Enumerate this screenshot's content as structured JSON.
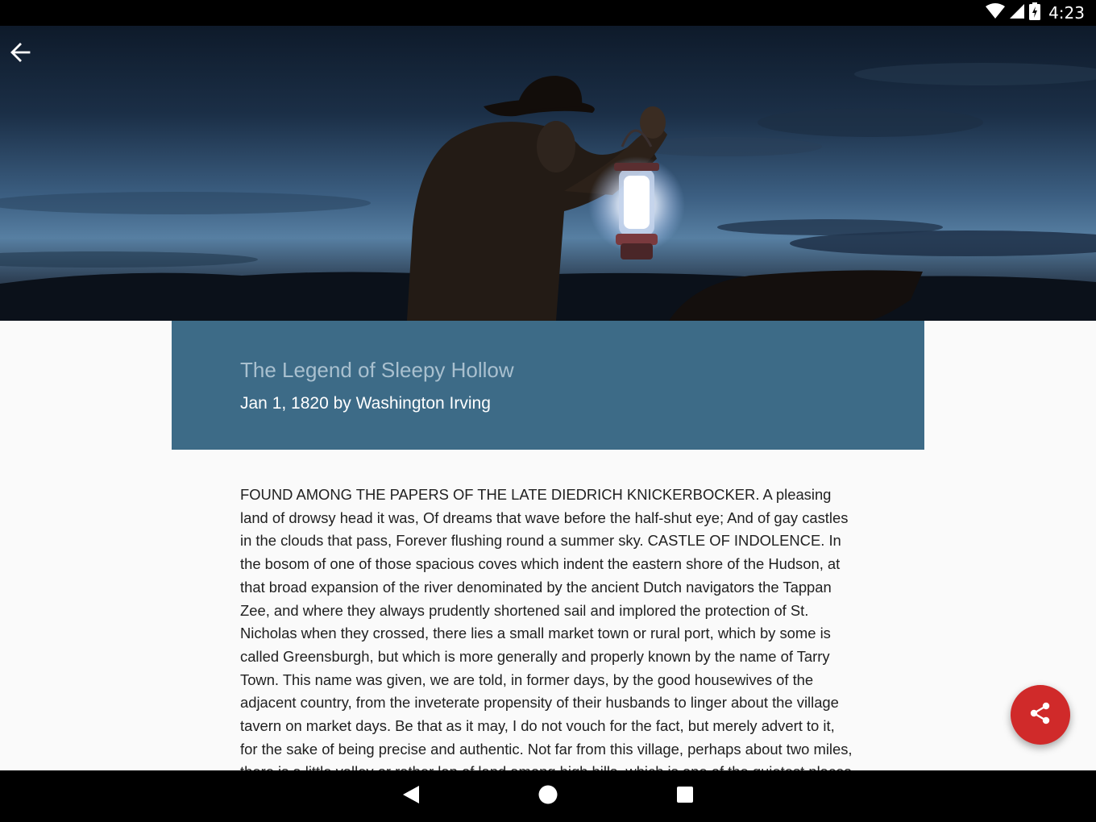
{
  "status_bar": {
    "time": "4:23",
    "icons": [
      "wifi-icon",
      "cell-signal-icon",
      "battery-charging-icon"
    ]
  },
  "toolbar": {
    "back_icon": "arrow-back-icon"
  },
  "hero": {
    "image": "person-with-lantern-at-dusk"
  },
  "article": {
    "title": "The Legend of Sleepy Hollow",
    "byline": "Jan 1, 1820 by Washington Irving",
    "body": "FOUND AMONG THE PAPERS OF THE LATE DIEDRICH KNICKERBOCKER. A pleasing land of drowsy head it was, Of dreams that wave before the half-shut eye; And of gay castles in the clouds that pass, Forever flushing round a summer sky. CASTLE OF INDOLENCE. In the bosom of one of those spacious coves which indent the eastern shore of the Hudson, at that broad expansion of the river denominated by the ancient Dutch navigators the Tappan Zee, and where they always prudently shortened sail and implored the protection of St. Nicholas when they crossed, there lies a small market town or rural port, which by some is called Greensburgh, but which is more generally and properly known by the name of Tarry Town. This name was given, we are told, in former days, by the good housewives of the adjacent country, from the inveterate propensity of their husbands to linger about the village tavern on market days. Be that as it may, I do not vouch for the fact, but merely advert to it, for the sake of being precise and authentic. Not far from this village, perhaps about two miles, there is a little valley or rather lap of land among high hills, which is one of the quietest places"
  },
  "fab": {
    "icon": "share-icon"
  },
  "colors": {
    "title_card": "#3d6b87",
    "title_text": "#a9c0cf",
    "fab": "#d02a2a",
    "background": "#fafafa"
  },
  "nav_bar": {
    "buttons": [
      "back-triangle-icon",
      "home-circle-icon",
      "recents-square-icon"
    ]
  }
}
